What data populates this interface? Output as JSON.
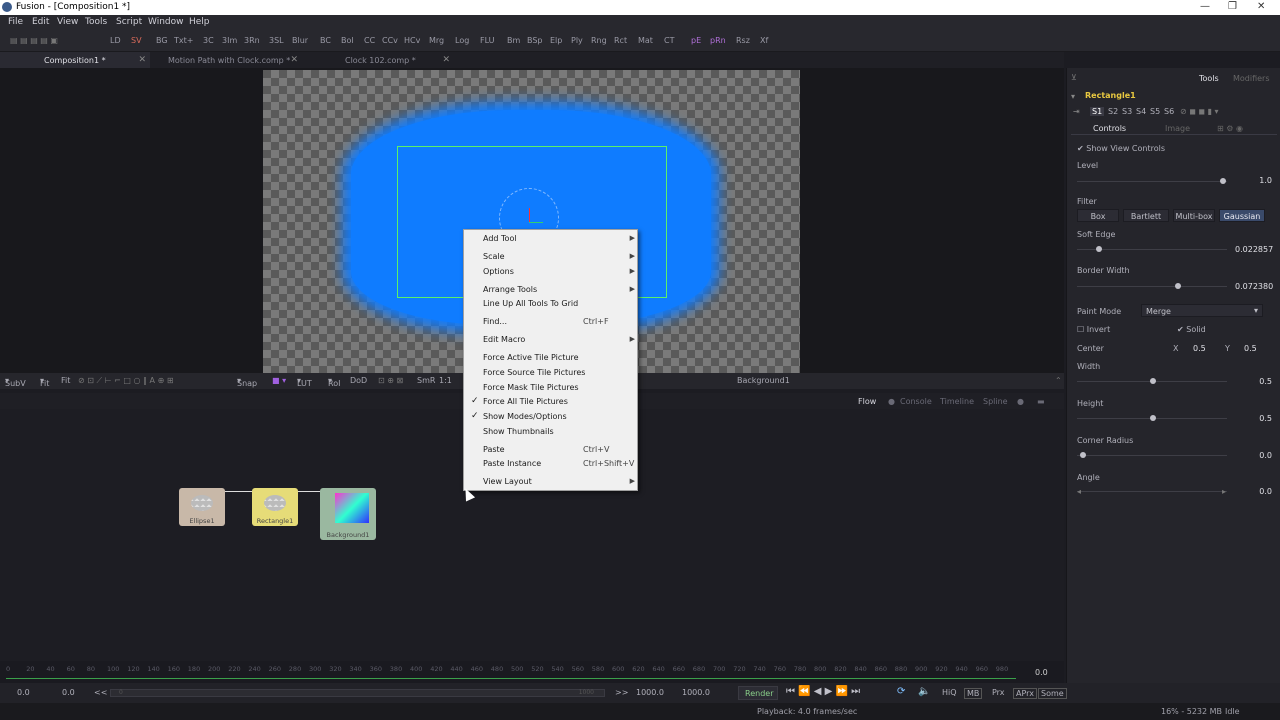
{
  "window": {
    "title": "Fusion - [Composition1 *]"
  },
  "menubar": [
    "File",
    "Edit",
    "View",
    "Tools",
    "Script",
    "Window",
    "Help"
  ],
  "toolbar": [
    "LD",
    "SV",
    "BG",
    "Txt+",
    "3C",
    "3Im",
    "3Rn",
    "3SL",
    "Blur",
    "BC",
    "Bol",
    "CC",
    "CCv",
    "HCv",
    "Mrg",
    "Log",
    "FLU",
    "Bm",
    "BSp",
    "Elp",
    "Ply",
    "Rng",
    "Rct",
    "Mat",
    "CT",
    "pE",
    "pRn",
    "Rsz",
    "Xf"
  ],
  "tabs": [
    {
      "label": "Composition1 *"
    },
    {
      "label": "Motion Path with Clock.comp *"
    },
    {
      "label": "Clock 102.comp *"
    }
  ],
  "viewer_toolbar": {
    "items": [
      "SubV",
      "Fit",
      "Fit",
      "Snap",
      "LUT",
      "RoI",
      "DoD",
      "SmR",
      "1:1"
    ],
    "view_name": "Background1"
  },
  "flow_tabs": [
    "Flow",
    "Console",
    "Timeline",
    "Spline"
  ],
  "nodes": [
    {
      "label": "Ellipse1"
    },
    {
      "label": "Rectangle1"
    },
    {
      "label": "Background1"
    }
  ],
  "context_menu": [
    {
      "label": "Add Tool",
      "submenu": true
    },
    {
      "label": "Scale",
      "submenu": true
    },
    {
      "label": "Options",
      "submenu": true
    },
    {
      "label": "Arrange Tools",
      "submenu": true
    },
    {
      "label": "Line Up All Tools To Grid"
    },
    {
      "label": "Find...",
      "shortcut": "Ctrl+F"
    },
    {
      "label": "Edit Macro",
      "submenu": true
    },
    {
      "label": "Force Active Tile Picture"
    },
    {
      "label": "Force Source Tile Pictures"
    },
    {
      "label": "Force Mask Tile Pictures"
    },
    {
      "label": "Force All Tile Pictures",
      "checked": true
    },
    {
      "label": "Show Modes/Options",
      "checked": true
    },
    {
      "label": "Show Thumbnails"
    },
    {
      "label": "Paste",
      "shortcut": "Ctrl+V"
    },
    {
      "label": "Paste Instance",
      "shortcut": "Ctrl+Shift+V"
    },
    {
      "label": "View Layout",
      "submenu": true
    }
  ],
  "inspector": {
    "tabs": [
      "Tools",
      "Modifiers"
    ],
    "tool_name": "Rectangle1",
    "slots": [
      "S1",
      "S2",
      "S3",
      "S4",
      "S5",
      "S6"
    ],
    "subtabs": [
      "Controls",
      "Image"
    ],
    "show_view_controls": "Show View Controls",
    "level": {
      "label": "Level",
      "value": "1.0"
    },
    "filter": {
      "label": "Filter",
      "options": [
        "Box",
        "Bartlett",
        "Multi-box",
        "Gaussian"
      ],
      "selected": "Gaussian"
    },
    "soft_edge": {
      "label": "Soft Edge",
      "value": "0.022857"
    },
    "border_width": {
      "label": "Border Width",
      "value": "0.072380"
    },
    "paint_mode": {
      "label": "Paint Mode",
      "value": "Merge"
    },
    "invert": "Invert",
    "solid": "Solid",
    "center": {
      "label": "Center",
      "x_label": "X",
      "x": "0.5",
      "y_label": "Y",
      "y": "0.5"
    },
    "width": {
      "label": "Width",
      "value": "0.5"
    },
    "height": {
      "label": "Height",
      "value": "0.5"
    },
    "corner_radius": {
      "label": "Corner Radius",
      "value": "0.0"
    },
    "angle": {
      "label": "Angle",
      "value": "0.0"
    }
  },
  "timeline": {
    "ticks": [
      "0",
      "20",
      "40",
      "60",
      "80",
      "100",
      "120",
      "140",
      "160",
      "180",
      "200",
      "220",
      "240",
      "260",
      "280",
      "300",
      "320",
      "340",
      "360",
      "380",
      "400",
      "420",
      "440",
      "460",
      "480",
      "500",
      "520",
      "540",
      "560",
      "580",
      "600",
      "620",
      "640",
      "660",
      "680",
      "700",
      "720",
      "740",
      "760",
      "780",
      "800",
      "820",
      "840",
      "860",
      "880",
      "900",
      "920",
      "940",
      "960",
      "980"
    ],
    "current": "0.0"
  },
  "transport": {
    "start": "0.0",
    "render_start": "0.0",
    "end": "1000.0",
    "global_end": "1000.0",
    "range_start": "0",
    "range_end": "1000",
    "render": "Render",
    "hiq": "HiQ",
    "mb": "MB",
    "prx": "Prx",
    "aprx": "APrx",
    "some": "Some",
    "back": "<<",
    "fwd": ">>"
  },
  "status": {
    "playback": "Playback: 4.0 frames/sec",
    "memory": "16% - 5232 MB",
    "state": "Idle"
  }
}
